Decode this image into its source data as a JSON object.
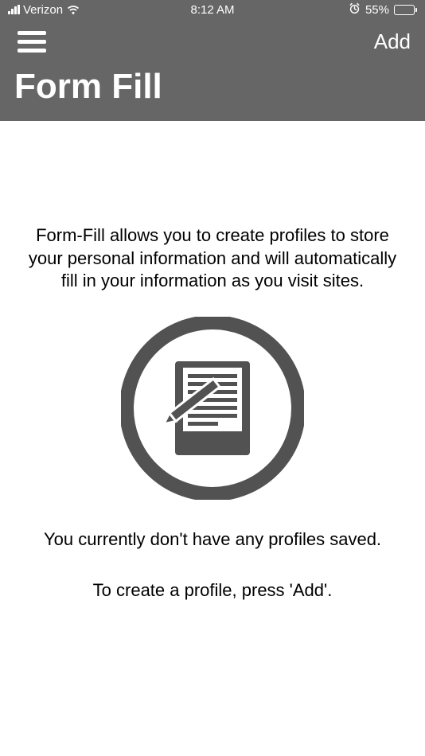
{
  "statusBar": {
    "carrier": "Verizon",
    "time": "8:12 AM",
    "batteryPercent": "55%",
    "batteryLevel": 55
  },
  "nav": {
    "addLabel": "Add"
  },
  "header": {
    "title": "Form Fill"
  },
  "main": {
    "intro": "Form-Fill allows you to create profiles to store your personal information and will automatically fill in your information as you visit sites.",
    "emptyState": "You currently don't have any profiles saved.",
    "ctaHint": "To create a profile, press 'Add'."
  },
  "colors": {
    "headerBg": "#666666",
    "docIconFill": "#525252"
  }
}
